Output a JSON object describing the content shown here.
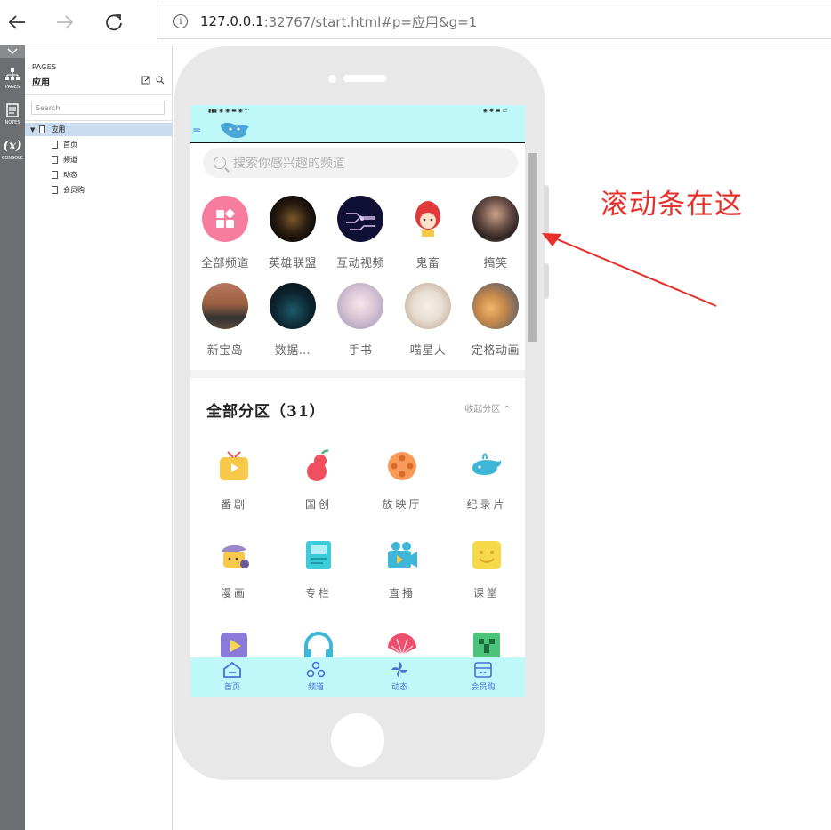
{
  "browser": {
    "url_host": "127.0.0.1",
    "url_rest": ":32767/start.html#p=应用&g=1"
  },
  "rail": {
    "items": [
      {
        "label": "PAGES",
        "icon": "sitemap-icon"
      },
      {
        "label": "NOTES",
        "icon": "notes-icon"
      },
      {
        "label": "CONSOLE",
        "icon": "variable-icon",
        "glyph": "(x)"
      }
    ]
  },
  "pages_panel": {
    "title": "PAGES",
    "current": "应用",
    "search_placeholder": "Search",
    "tree": {
      "root": "应用",
      "children": [
        "首页",
        "频道",
        "动态",
        "会员购"
      ]
    }
  },
  "app": {
    "search_placeholder": "搜索你感兴趣的频道",
    "channels_row1": [
      "全部频道",
      "英雄联盟",
      "互动视频",
      "鬼畜",
      "搞笑"
    ],
    "channels_row2": [
      "新宝岛",
      "数据…",
      "手书",
      "喵星人",
      "定格动画"
    ],
    "section_title": "全部分区（31）",
    "section_action": "收起分区",
    "categories_row1": [
      "番剧",
      "国创",
      "放映厅",
      "纪录片"
    ],
    "categories_row2": [
      "漫画",
      "专栏",
      "直播",
      "课堂"
    ],
    "tabs": [
      "首页",
      "频道",
      "动态",
      "会员购"
    ]
  },
  "annotation": {
    "text": "滚动条在这",
    "color": "#e8302b"
  },
  "colors": {
    "app_bar": "#bff8f8",
    "accent": "#4a6fd8"
  }
}
